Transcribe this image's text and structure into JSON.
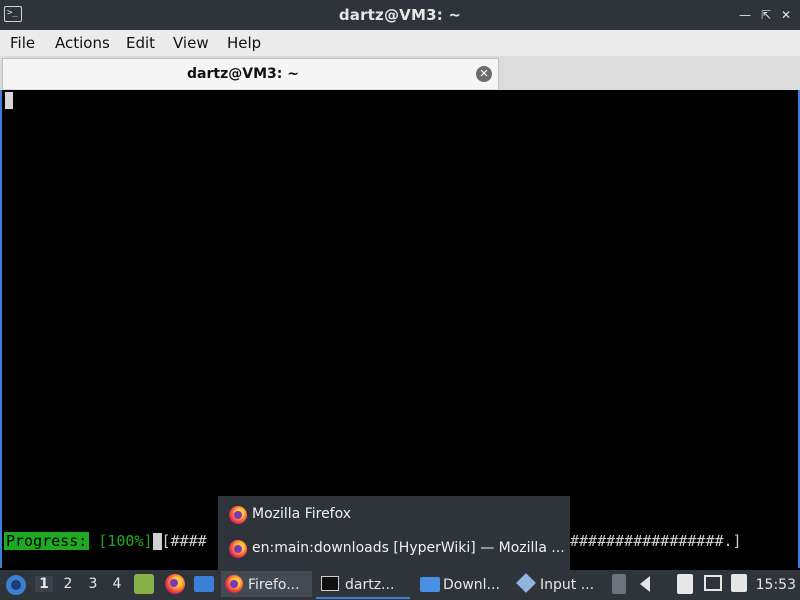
{
  "window": {
    "title": "dartz@VM3: ~",
    "app_icon_text": ">_"
  },
  "menu": {
    "items": [
      "File",
      "Actions",
      "Edit",
      "View",
      "Help"
    ]
  },
  "tab": {
    "label": "dartz@VM3: ~"
  },
  "terminal": {
    "progress_label": "Progress:",
    "progress_percent": "[100%]",
    "progress_bar_left": "[####",
    "progress_bar_right": "#################.]"
  },
  "popup": {
    "items": [
      {
        "label": "Mozilla Firefox",
        "icon": "firefox-icon"
      },
      {
        "label": "en:main:downloads [HyperWiki] — Mozilla ...",
        "icon": "firefox-icon"
      }
    ]
  },
  "taskbar": {
    "workspaces": [
      "1",
      "2",
      "3",
      "4"
    ],
    "active_workspace": "1",
    "buttons": [
      {
        "label": "Firefo...",
        "icon": "firefox-icon"
      },
      {
        "label": "dartz...",
        "icon": "terminal-icon"
      },
      {
        "label": "Downl...",
        "icon": "folder-icon"
      },
      {
        "label": "Input ...",
        "icon": "input-icon"
      }
    ],
    "clock": "15:53"
  },
  "colors": {
    "accent": "#3c7fd6",
    "panel": "#2f343b",
    "progress_green": "#1eaa20"
  }
}
